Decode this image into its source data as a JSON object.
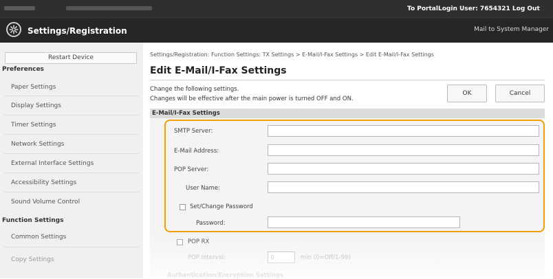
{
  "topbar": {
    "to_portal": "To Portal",
    "login_user": "Login User:  7654321  Log Out"
  },
  "header": {
    "icon": "gear-icon",
    "title": "Settings/Registration",
    "mail_to": "Mail to System Manager"
  },
  "sidebar": {
    "restart_label": "Restart Device",
    "preferences_heading": "Preferences",
    "preferences_items": [
      "Paper Settings",
      "Display Settings",
      "Timer Settings",
      "Network Settings",
      "External Interface Settings",
      "Accessibility Settings",
      "Sound Volume Control"
    ],
    "function_heading": "Function Settings",
    "function_items": [
      "Common Settings",
      "Copy Settings"
    ]
  },
  "main": {
    "breadcrumb": "Settings/Registration: Function Settings: TX Settings > E-Mail/I-Fax Settings > Edit E-Mail/I-Fax Settings",
    "title": "Edit E-Mail/I-Fax Settings",
    "desc1": "Change the following settings.",
    "desc2": "Changes will be effective after the main power is turned OFF and ON.",
    "ok_label": "OK",
    "cancel_label": "Cancel",
    "section_title": "E-Mail/I-Fax Settings",
    "fields": {
      "smtp_label": "SMTP Server:",
      "smtp_value": "",
      "email_label": "E-Mail Address:",
      "email_value": "",
      "pop_label": "POP Server:",
      "pop_value": "",
      "username_label": "User Name:",
      "username_value": "",
      "set_password_label": "Set/Change Password",
      "password_label": "Password:",
      "password_value": "",
      "pop_rx_label": "POP RX",
      "pop_interval_label": "POP Interval:",
      "pop_interval_value": "0",
      "pop_interval_unit": "min (0=Off/1-99)"
    },
    "next_section": "Authentication/Encryption Settings"
  },
  "colors": {
    "highlight": "#f0a000",
    "topbar": "#2f2f2f",
    "header": "#262626"
  }
}
